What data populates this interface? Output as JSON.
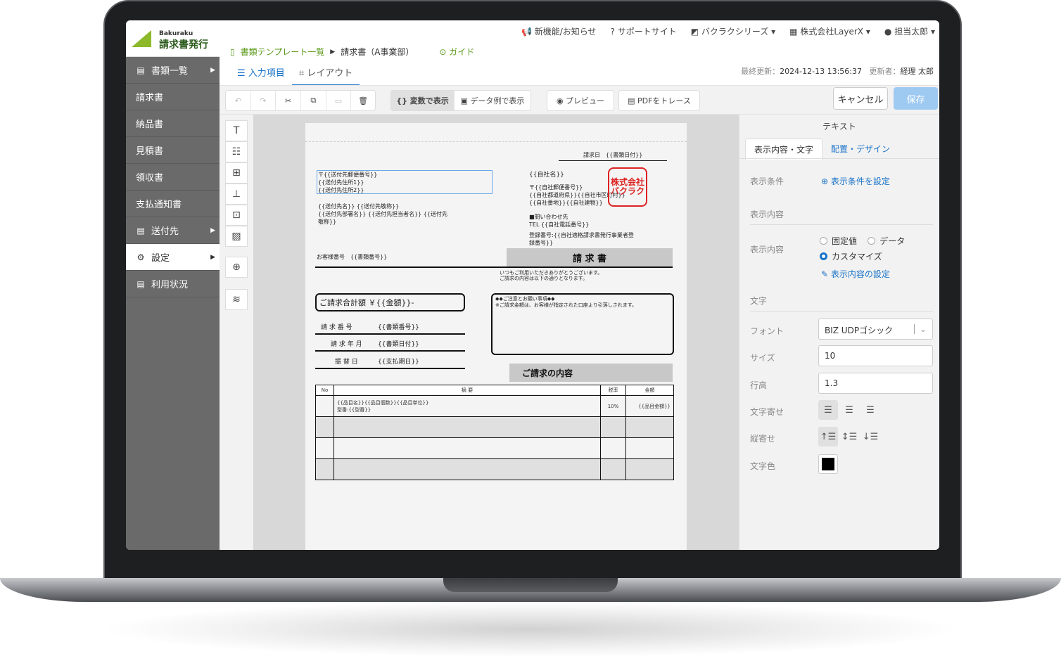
{
  "app": {
    "logo_small": "Bakuraku",
    "logo_main": "請求書発行"
  },
  "sidebar": {
    "items": [
      {
        "label": "書類一覧",
        "icon": "document-icon",
        "arrow": "▶"
      },
      {
        "label": "請求書"
      },
      {
        "label": "納品書"
      },
      {
        "label": "見積書"
      },
      {
        "label": "領収書"
      },
      {
        "label": "支払通知書"
      },
      {
        "label": "送付先",
        "icon": "document-icon",
        "arrow": "▶"
      },
      {
        "label": "設定",
        "icon": "gear-icon",
        "arrow": "▶"
      },
      {
        "label": "利用状況",
        "icon": "document-icon"
      }
    ]
  },
  "topbar": {
    "news": "新機能/お知らせ",
    "support": "サポートサイト",
    "series": "バクラクシリーズ",
    "company": "株式会社LayerX",
    "user": "担当太郎"
  },
  "breadcrumb": {
    "list": "書類テンプレート一覧",
    "current": "請求書（A事業部）",
    "guide": "ガイド"
  },
  "tabs": {
    "input": "入力項目",
    "layout": "レイアウト"
  },
  "last_update": {
    "label": "最終更新：",
    "value": "2024-12-13 13:56:37",
    "updater_label": "更新者：",
    "updater": "経理 太郎"
  },
  "toolbar": {
    "var_display": "変数で表示",
    "data_display": "データ例で表示",
    "preview": "プレビュー",
    "pdf_trace": "PDFをトレース",
    "cancel": "キャンセル",
    "save": "保存"
  },
  "doc": {
    "date_label": "請求日　{{書類日付}}",
    "addr_lines": [
      "〒{{送付先郵便番号}}",
      "{{送付先住所1}}",
      "{{送付先住所2}}"
    ],
    "name_lines": [
      "{{送付先名}} {{送付先敬称}}",
      "{{送付先部署名}} {{送付先担当者名}} {{送付先",
      "敬称}}"
    ],
    "company_name": "{{自社名}}",
    "company_lines": [
      "〒{{自社郵便番号}}",
      "{{自社都道府県}}{{自社市区町村}}",
      "{{自社番地}}{{自社建物}}"
    ],
    "contact_lines": [
      "■問い合わせ先",
      " TEL {{自社電話番号}}"
    ],
    "reg_lines": [
      "登録番号:{{自社適格請求書発行事業者登",
      "録番号}}"
    ],
    "seal": "株式会社バクラク",
    "customer_no": "お客様番号　{{書類番号}}",
    "title": "請 求 書",
    "greeting_lines": [
      "いつもご利用いただきありがとうございます。",
      "ご請求の内容は以下の通りとなります。"
    ],
    "total": "ご請求合計額 ￥{{金額}}-",
    "fields": [
      {
        "label": "請 求 番 号",
        "value": "{{書類番号}}"
      },
      {
        "label": "請 求 年 月",
        "value": "{{書類日付}}"
      },
      {
        "label": "振 替 日",
        "value": "{{支払期日}}"
      }
    ],
    "notice_lines": [
      "◆◆ご注意とお願い事項◆◆",
      "※ご請求金額は、お客様が指定された口座より引落しされます。"
    ],
    "detail_title": "ご請求の内容",
    "table_headers": [
      "No",
      "摘 要",
      "税率",
      "金額"
    ],
    "row1_desc": [
      "{{品目名}}{{品目個数}}{{品目単位}}",
      "型番:{{型番}}"
    ],
    "row1_rate": "10%",
    "row1_amount": "{{品目金額}}"
  },
  "panel": {
    "title": "テキスト",
    "tab1": "表示内容・文字",
    "tab2": "配置・デザイン",
    "cond_label": "表示条件",
    "cond_link": "表示条件を設定",
    "content_section": "表示内容",
    "content_label": "表示内容",
    "radio_fixed": "固定値",
    "radio_data": "データ",
    "radio_custom": "カスタマイズ",
    "content_link": "表示内容の設定",
    "text_section": "文字",
    "font_label": "フォント",
    "font_value": "BIZ UDPゴシック",
    "size_label": "サイズ",
    "size_value": "10",
    "line_label": "行高",
    "line_value": "1.3",
    "halign_label": "文字寄せ",
    "valign_label": "縦寄せ",
    "color_label": "文字色",
    "text_color": "#000000"
  }
}
